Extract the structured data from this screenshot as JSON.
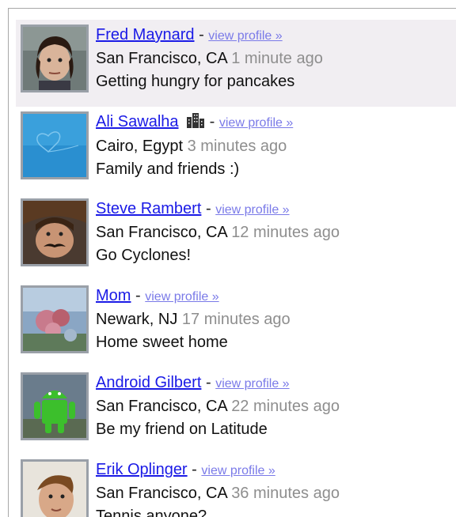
{
  "feed": {
    "items": [
      {
        "name": "Fred Maynard",
        "separator": "-",
        "profile_link": "view profile »",
        "location": "San Francisco, CA",
        "time": "1 minute ago",
        "status": "Getting hungry for pancakes",
        "selected": true
      },
      {
        "name": "Ali Sawalha",
        "separator": "-",
        "profile_link": "view profile »",
        "location": "Cairo, Egypt",
        "time": "3 minutes ago",
        "status": "Family and friends :)",
        "badge_icon": "building-icon"
      },
      {
        "name": "Steve Rambert",
        "separator": "-",
        "profile_link": "view profile »",
        "location": "San Francisco, CA",
        "time": "12 minutes ago",
        "status": "Go Cyclones!"
      },
      {
        "name": "Mom",
        "separator": "-",
        "profile_link": "view profile »",
        "location": "Newark, NJ",
        "time": "17 minutes ago",
        "status": "Home sweet home"
      },
      {
        "name": "Android Gilbert",
        "separator": "-",
        "profile_link": "view profile »",
        "location": "San Francisco, CA",
        "time": "22 minutes ago",
        "status": "Be my friend on Latitude"
      },
      {
        "name": "Erik Oplinger",
        "separator": "-",
        "profile_link": "view profile »",
        "location": "San Francisco, CA",
        "time": "36 minutes ago",
        "status": "Tennis anyone?"
      }
    ]
  },
  "colors": {
    "link": "#1a1ae6",
    "profile_link": "#7a7ae8",
    "time": "#8e8e8e",
    "selected_bg": "#f1eef2"
  }
}
